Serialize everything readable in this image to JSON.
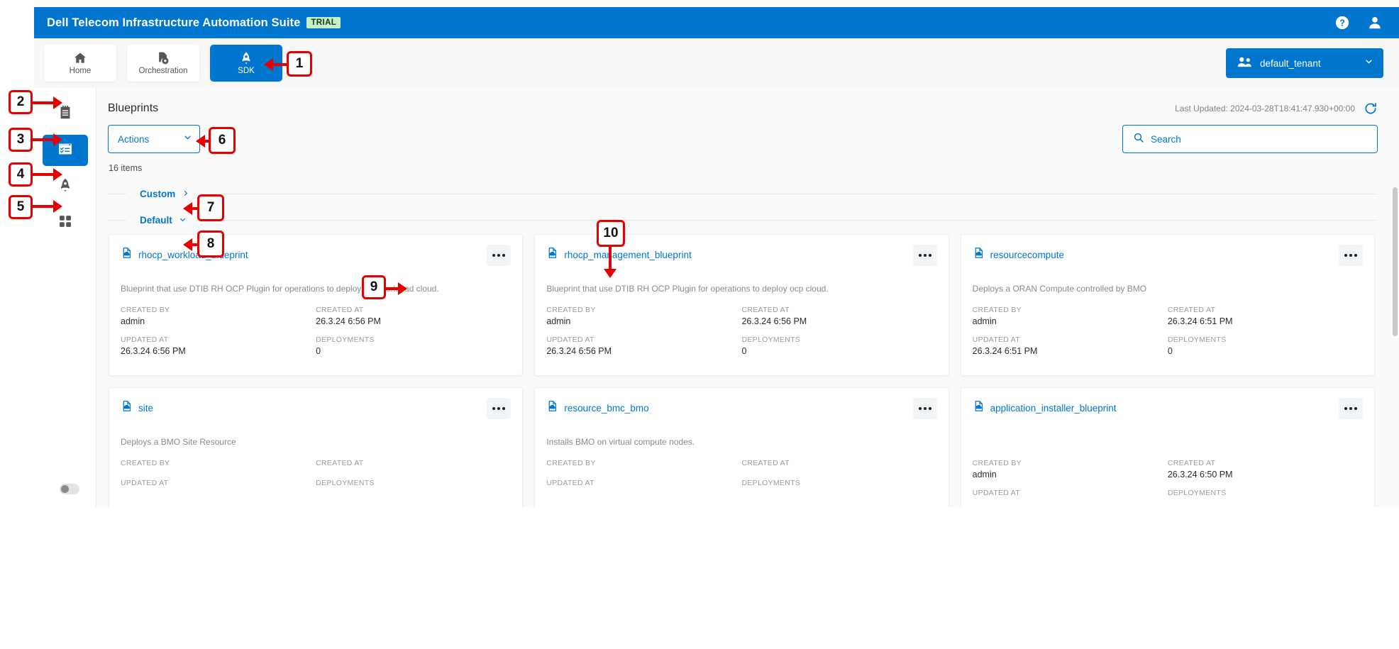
{
  "app": {
    "title": "Dell Telecom Infrastructure Automation Suite",
    "trial_badge": "TRIAL",
    "brand_color": "#0076ce",
    "help_icon": "help-circle-icon",
    "user_icon": "user-account-icon"
  },
  "tabs": [
    {
      "label": "Home",
      "icon": "home-icon",
      "active": false
    },
    {
      "label": "Orchestration",
      "icon": "orchestration-gear-document-icon",
      "active": false
    },
    {
      "label": "SDK",
      "icon": "rocket-icon",
      "active": true
    }
  ],
  "tenant": {
    "label": "default_tenant",
    "icon": "people-group-icon",
    "chevron": "chevron-down-icon"
  },
  "sidebar": {
    "items": [
      {
        "name": "notepad",
        "icon": "notepad-icon",
        "active": false
      },
      {
        "name": "blueprints",
        "icon": "checklist-icon",
        "active": true
      },
      {
        "name": "deployments",
        "icon": "rocket-icon",
        "active": false
      },
      {
        "name": "apps",
        "icon": "grid-apps-icon",
        "active": false
      }
    ],
    "collapse_toggle": "sidebar-collapse-toggle"
  },
  "page": {
    "title": "Blueprints",
    "last_updated": "Last Updated: 2024-03-28T18:41:47.930+00:00",
    "refresh_icon": "refresh-icon",
    "item_count": "16 items"
  },
  "toolbar": {
    "actions_label": "Actions",
    "actions_chevron": "chevron-down-icon",
    "search_placeholder": "Search",
    "search_value": "",
    "search_icon": "search-icon"
  },
  "groups": [
    {
      "label": "Custom",
      "expanded": false,
      "chevron": "chevron-right-icon"
    },
    {
      "label": "Default",
      "expanded": true,
      "chevron": "chevron-down-icon"
    }
  ],
  "meta_labels": {
    "created_by": "CREATED BY",
    "created_at": "CREATED AT",
    "updated_at": "UPDATED AT",
    "deployments": "DEPLOYMENTS"
  },
  "cards": [
    {
      "title": "rhocp_workload_blueprint",
      "icon": "blueprint-file-icon",
      "description": "Blueprint that use DTIB RH OCP Plugin for operations to deploy ocp workload cloud.",
      "created_by": "admin",
      "created_at": "26.3.24 6:56 PM",
      "updated_at": "26.3.24 6:56 PM",
      "deployments": "0",
      "menu_icon": "kebab-menu-icon"
    },
    {
      "title": "rhocp_management_blueprint",
      "icon": "blueprint-file-icon",
      "description": "Blueprint that use DTIB RH OCP Plugin for operations to deploy ocp cloud.",
      "created_by": "admin",
      "created_at": "26.3.24 6:56 PM",
      "updated_at": "26.3.24 6:56 PM",
      "deployments": "0",
      "menu_icon": "kebab-menu-icon"
    },
    {
      "title": "resourcecompute",
      "icon": "blueprint-file-icon",
      "description": "Deploys a ORAN Compute controlled by BMO",
      "created_by": "admin",
      "created_at": "26.3.24 6:51 PM",
      "updated_at": "26.3.24 6:51 PM",
      "deployments": "0",
      "menu_icon": "kebab-menu-icon"
    },
    {
      "title": "site",
      "icon": "blueprint-file-icon",
      "description": "Deploys a BMO Site Resource",
      "created_by": "",
      "created_at": "",
      "updated_at": "",
      "deployments": "",
      "menu_icon": "kebab-menu-icon"
    },
    {
      "title": "resource_bmc_bmo",
      "icon": "blueprint-file-icon",
      "description": "Installs BMO on virtual compute nodes.",
      "created_by": "",
      "created_at": "",
      "updated_at": "",
      "deployments": "",
      "menu_icon": "kebab-menu-icon"
    },
    {
      "title": "application_installer_blueprint",
      "icon": "blueprint-file-icon",
      "description": "",
      "created_by": "admin",
      "created_at": "26.3.24 6:50 PM",
      "updated_at": "",
      "deployments": "",
      "menu_icon": "kebab-menu-icon"
    }
  ],
  "annotations": {
    "color": "#e60000",
    "markers": [
      {
        "id": "1",
        "label": "1"
      },
      {
        "id": "2",
        "label": "2"
      },
      {
        "id": "3",
        "label": "3"
      },
      {
        "id": "4",
        "label": "4"
      },
      {
        "id": "5",
        "label": "5"
      },
      {
        "id": "6",
        "label": "6"
      },
      {
        "id": "7",
        "label": "7"
      },
      {
        "id": "8",
        "label": "8"
      },
      {
        "id": "9",
        "label": "9"
      },
      {
        "id": "10",
        "label": "10"
      }
    ]
  }
}
